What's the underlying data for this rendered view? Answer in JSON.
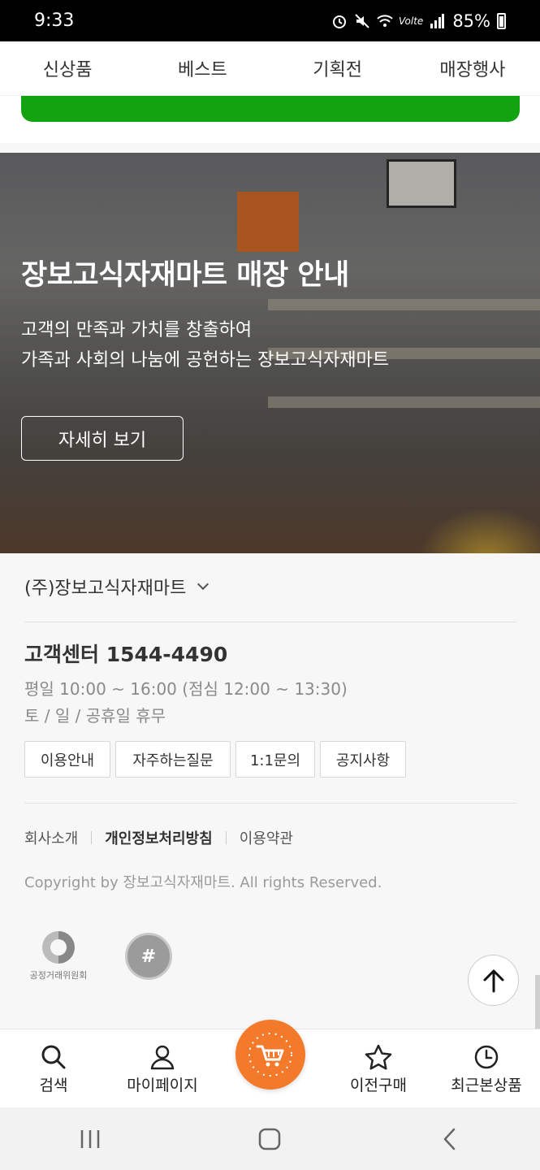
{
  "status_bar": {
    "time": "9:33",
    "battery": "85%",
    "network": "Volte"
  },
  "top_nav": {
    "items": [
      "신상품",
      "베스트",
      "기획전",
      "매장행사"
    ]
  },
  "banner": {
    "title": "장보고식자재마트 매장 안내",
    "desc_line1": "고객의 만족과 가치를 창출하여",
    "desc_line2": "가족과 사회의 나눔에 공헌하는 장보고식자재마트",
    "button_label": "자세히 보기"
  },
  "footer": {
    "company_name": "(주)장보고식자재마트",
    "customer_center": "고객센터 1544-4490",
    "hours_line1": "평일 10:00 ~ 16:00 (점심 12:00 ~ 13:30)",
    "hours_line2": "토 / 일 / 공휴일 휴무",
    "links": [
      "이용안내",
      "자주하는질문",
      "1:1문의",
      "공지사항"
    ],
    "policy_links": [
      "회사소개",
      "개인정보처리방침",
      "이용약관"
    ],
    "copyright": "Copyright by 장보고식자재마트. All rights Reserved.",
    "ftc_label": "공정거래위원회",
    "escrow_symbol": "#"
  },
  "bottom_nav": {
    "search": "검색",
    "mypage": "마이페이지",
    "previous_orders": "이전구매",
    "recent_viewed": "최근본상품"
  },
  "colors": {
    "accent_green": "#13a310",
    "cart_orange": "#f37a2b"
  }
}
